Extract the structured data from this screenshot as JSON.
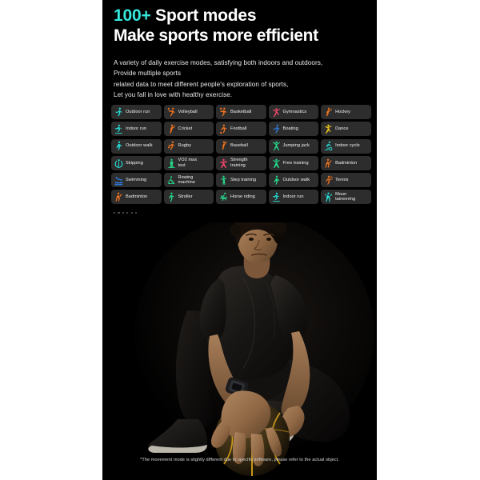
{
  "header": {
    "count": "100+",
    "title_rest": " Sport modes",
    "subtitle": "Make sports more efficient",
    "accent_color": "#34e8dc"
  },
  "description": {
    "line1": "A variety of daily exercise modes, satisfying both indoors and outdoors,",
    "line2": "Provide multiple sports",
    "line3": "related data to meet different people's exploration of sports,",
    "line4": "Let you fall in love with healthy exercise."
  },
  "sport_modes": [
    {
      "label": "Outdoor run",
      "icon": "runner-icon",
      "color": "#24e0d8"
    },
    {
      "label": "Volleyball",
      "icon": "volleyball-icon",
      "color": "#ef7321"
    },
    {
      "label": "Basketball",
      "icon": "basketball-icon",
      "color": "#ef7321"
    },
    {
      "label": "Gymnastics",
      "icon": "gymnastics-icon",
      "color": "#f0476b"
    },
    {
      "label": "Hockey",
      "icon": "hockey-icon",
      "color": "#ef7321"
    },
    {
      "label": "Indoor run",
      "icon": "treadmill-icon",
      "color": "#24e0d8"
    },
    {
      "label": "Cricket",
      "icon": "cricket-icon",
      "color": "#ef7321"
    },
    {
      "label": "Football",
      "icon": "football-icon",
      "color": "#ef7321"
    },
    {
      "label": "Boating",
      "icon": "rowing-boat-icon",
      "color": "#2e7de0"
    },
    {
      "label": "Dance",
      "icon": "dance-icon",
      "color": "#f2c91b"
    },
    {
      "label": "Outdoor walk",
      "icon": "walking-icon",
      "color": "#24e0d8"
    },
    {
      "label": "Rugby",
      "icon": "rugby-icon",
      "color": "#ef7321"
    },
    {
      "label": "Baseball",
      "icon": "baseball-icon",
      "color": "#ef7321"
    },
    {
      "label": "Jumping jack",
      "icon": "jumping-jack-icon",
      "color": "#25d98c"
    },
    {
      "label": "Indoor cycle",
      "icon": "indoor-cycle-icon",
      "color": "#24e0d8"
    },
    {
      "label": "Skipping",
      "icon": "skipping-rope-icon",
      "color": "#24e0d8"
    },
    {
      "label": "VO2 max\ntest",
      "icon": "vo2-max-icon",
      "color": "#25d98c"
    },
    {
      "label": "Strength\ntraining",
      "icon": "strength-icon",
      "color": "#f0476b"
    },
    {
      "label": "Free training",
      "icon": "free-training-icon",
      "color": "#25d98c"
    },
    {
      "label": "Badminton",
      "icon": "badminton-icon",
      "color": "#ef7321"
    },
    {
      "label": "Swimming",
      "icon": "swimming-icon",
      "color": "#2e7de0"
    },
    {
      "label": "Rowing\nmachine",
      "icon": "rowing-machine-icon",
      "color": "#25d98c"
    },
    {
      "label": "Step training",
      "icon": "step-training-icon",
      "color": "#25d98c"
    },
    {
      "label": "Outdoor walk",
      "icon": "walking-icon",
      "color": "#25d98c"
    },
    {
      "label": "Tennis",
      "icon": "tennis-icon",
      "color": "#ef7321"
    },
    {
      "label": "Badminton",
      "icon": "badminton-icon",
      "color": "#ef7321"
    },
    {
      "label": "Stroller",
      "icon": "stroller-icon",
      "color": "#25d98c"
    },
    {
      "label": "Horse riding",
      "icon": "horse-riding-icon",
      "color": "#25d98c"
    },
    {
      "label": "Indoor run",
      "icon": "treadmill-icon",
      "color": "#24e0d8"
    },
    {
      "label": "Moun\ntaineering",
      "icon": "mountaineering-icon",
      "color": "#24e0d8"
    }
  ],
  "pagination_dots": 6,
  "photo": {
    "alt": "Athlete in black sportswear crouching with a basketball, wearing a smartwatch"
  },
  "disclaimer": "*The movement mode is slightly different due to specific software, please refer to the actual object."
}
